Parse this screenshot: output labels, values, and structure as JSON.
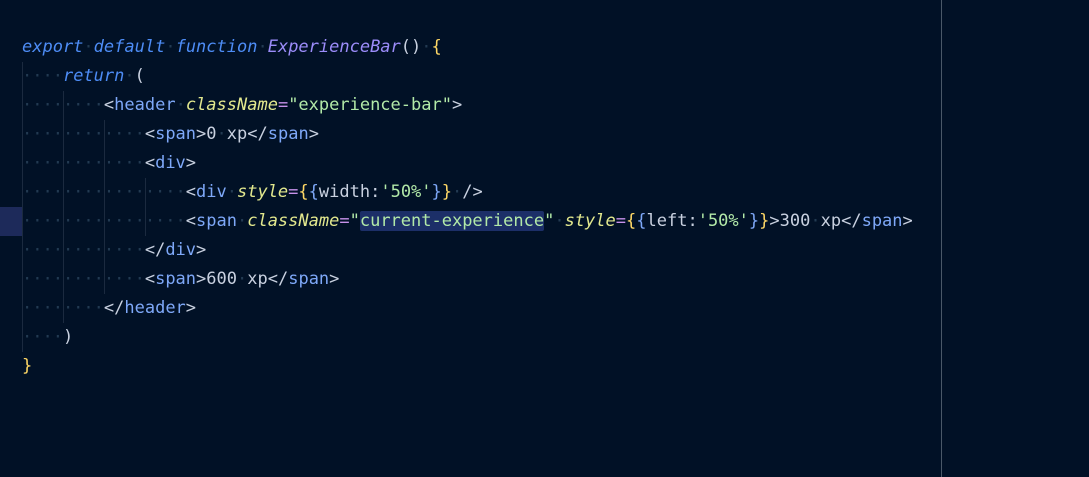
{
  "editor": {
    "lines": [
      {
        "tokens": [
          {
            "t": "export",
            "c": "kw"
          },
          {
            "t": "·",
            "c": "ws"
          },
          {
            "t": "default",
            "c": "kw"
          },
          {
            "t": "·",
            "c": "ws"
          },
          {
            "t": "function",
            "c": "kw"
          },
          {
            "t": "·",
            "c": "ws"
          },
          {
            "t": "ExperienceBar",
            "c": "fn"
          },
          {
            "t": "()",
            "c": "punc"
          },
          {
            "t": "·",
            "c": "ws"
          },
          {
            "t": "{",
            "c": "br"
          }
        ]
      },
      {
        "tokens": [
          {
            "t": "····",
            "c": "ws"
          },
          {
            "t": "return",
            "c": "kw"
          },
          {
            "t": "·",
            "c": "ws"
          },
          {
            "t": "(",
            "c": "punc"
          }
        ]
      },
      {
        "tokens": [
          {
            "t": "········",
            "c": "ws"
          },
          {
            "t": "<",
            "c": "punc"
          },
          {
            "t": "header",
            "c": "tag"
          },
          {
            "t": "·",
            "c": "ws"
          },
          {
            "t": "className",
            "c": "attr"
          },
          {
            "t": "=",
            "c": "op"
          },
          {
            "t": "\"experience-bar\"",
            "c": "str"
          },
          {
            "t": ">",
            "c": "punc"
          }
        ]
      },
      {
        "tokens": [
          {
            "t": "············",
            "c": "ws"
          },
          {
            "t": "<",
            "c": "punc"
          },
          {
            "t": "span",
            "c": "tag"
          },
          {
            "t": ">",
            "c": "punc"
          },
          {
            "t": "0",
            "c": "punc"
          },
          {
            "t": "·",
            "c": "ws"
          },
          {
            "t": "xp",
            "c": "punc"
          },
          {
            "t": "</",
            "c": "punc"
          },
          {
            "t": "span",
            "c": "tag"
          },
          {
            "t": ">",
            "c": "punc"
          }
        ]
      },
      {
        "tokens": [
          {
            "t": "············",
            "c": "ws"
          },
          {
            "t": "<",
            "c": "punc"
          },
          {
            "t": "div",
            "c": "tag"
          },
          {
            "t": ">",
            "c": "punc"
          }
        ]
      },
      {
        "tokens": [
          {
            "t": "················",
            "c": "ws"
          },
          {
            "t": "<",
            "c": "punc"
          },
          {
            "t": "div",
            "c": "tag"
          },
          {
            "t": "·",
            "c": "ws"
          },
          {
            "t": "style",
            "c": "attr"
          },
          {
            "t": "=",
            "c": "op"
          },
          {
            "t": "{",
            "c": "br"
          },
          {
            "t": "{",
            "c": "tag"
          },
          {
            "t": "width:",
            "c": "punc"
          },
          {
            "t": "'50%'",
            "c": "str"
          },
          {
            "t": "}",
            "c": "tag"
          },
          {
            "t": "}",
            "c": "br"
          },
          {
            "t": "·",
            "c": "ws"
          },
          {
            "t": "/>",
            "c": "punc"
          }
        ]
      },
      {
        "marker": true,
        "tokens": [
          {
            "t": "················",
            "c": "ws"
          },
          {
            "t": "<",
            "c": "punc"
          },
          {
            "t": "span",
            "c": "tag"
          },
          {
            "t": "·",
            "c": "ws"
          },
          {
            "t": "className",
            "c": "attr"
          },
          {
            "t": "=",
            "c": "op"
          },
          {
            "t": "\"",
            "c": "str"
          },
          {
            "t": "current-experience",
            "c": "str sel"
          },
          {
            "t": "\"",
            "c": "str"
          },
          {
            "t": "·",
            "c": "ws"
          },
          {
            "t": "style",
            "c": "attr"
          },
          {
            "t": "=",
            "c": "op"
          },
          {
            "t": "{",
            "c": "br"
          },
          {
            "t": "{",
            "c": "tag"
          },
          {
            "t": "left:",
            "c": "punc"
          },
          {
            "t": "'50%'",
            "c": "str"
          },
          {
            "t": "}",
            "c": "tag"
          },
          {
            "t": "}",
            "c": "br"
          },
          {
            "t": ">",
            "c": "punc"
          },
          {
            "t": "300",
            "c": "punc"
          },
          {
            "t": "·",
            "c": "ws"
          },
          {
            "t": "xp",
            "c": "punc"
          },
          {
            "t": "</",
            "c": "punc"
          },
          {
            "t": "span",
            "c": "tag"
          },
          {
            "t": ">",
            "c": "punc"
          }
        ]
      },
      {
        "tokens": [
          {
            "t": "············",
            "c": "ws"
          },
          {
            "t": "</",
            "c": "punc"
          },
          {
            "t": "div",
            "c": "tag"
          },
          {
            "t": ">",
            "c": "punc"
          }
        ]
      },
      {
        "tokens": [
          {
            "t": "············",
            "c": "ws"
          },
          {
            "t": "<",
            "c": "punc"
          },
          {
            "t": "span",
            "c": "tag"
          },
          {
            "t": ">",
            "c": "punc"
          },
          {
            "t": "600",
            "c": "punc"
          },
          {
            "t": "·",
            "c": "ws"
          },
          {
            "t": "xp",
            "c": "punc"
          },
          {
            "t": "</",
            "c": "punc"
          },
          {
            "t": "span",
            "c": "tag"
          },
          {
            "t": ">",
            "c": "punc"
          }
        ]
      },
      {
        "tokens": [
          {
            "t": "········",
            "c": "ws"
          },
          {
            "t": "</",
            "c": "punc"
          },
          {
            "t": "header",
            "c": "tag"
          },
          {
            "t": ">",
            "c": "punc"
          }
        ]
      },
      {
        "tokens": [
          {
            "t": "····",
            "c": "ws"
          },
          {
            "t": ")",
            "c": "punc"
          }
        ]
      },
      {
        "tokens": [
          {
            "t": "}",
            "c": "br"
          }
        ]
      }
    ]
  }
}
